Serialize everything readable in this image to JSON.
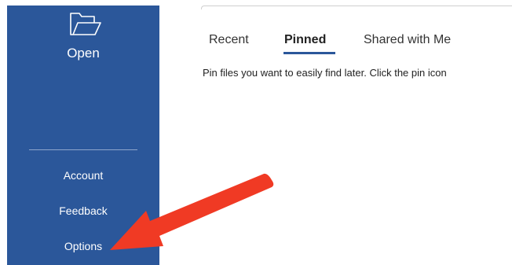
{
  "sidebar": {
    "open_label": "Open",
    "open_icon": "folder-open-icon",
    "links": {
      "account": "Account",
      "feedback": "Feedback",
      "options": "Options"
    },
    "background_color": "#2b579a"
  },
  "main": {
    "tabs": {
      "recent": "Recent",
      "pinned": "Pinned",
      "shared": "Shared with Me"
    },
    "active_tab": "Pinned",
    "hint_text": "Pin files you want to easily find later. Click the pin icon"
  },
  "annotation": {
    "arrow_color": "#f03a24",
    "arrow_icon": "red-arrow-icon"
  }
}
